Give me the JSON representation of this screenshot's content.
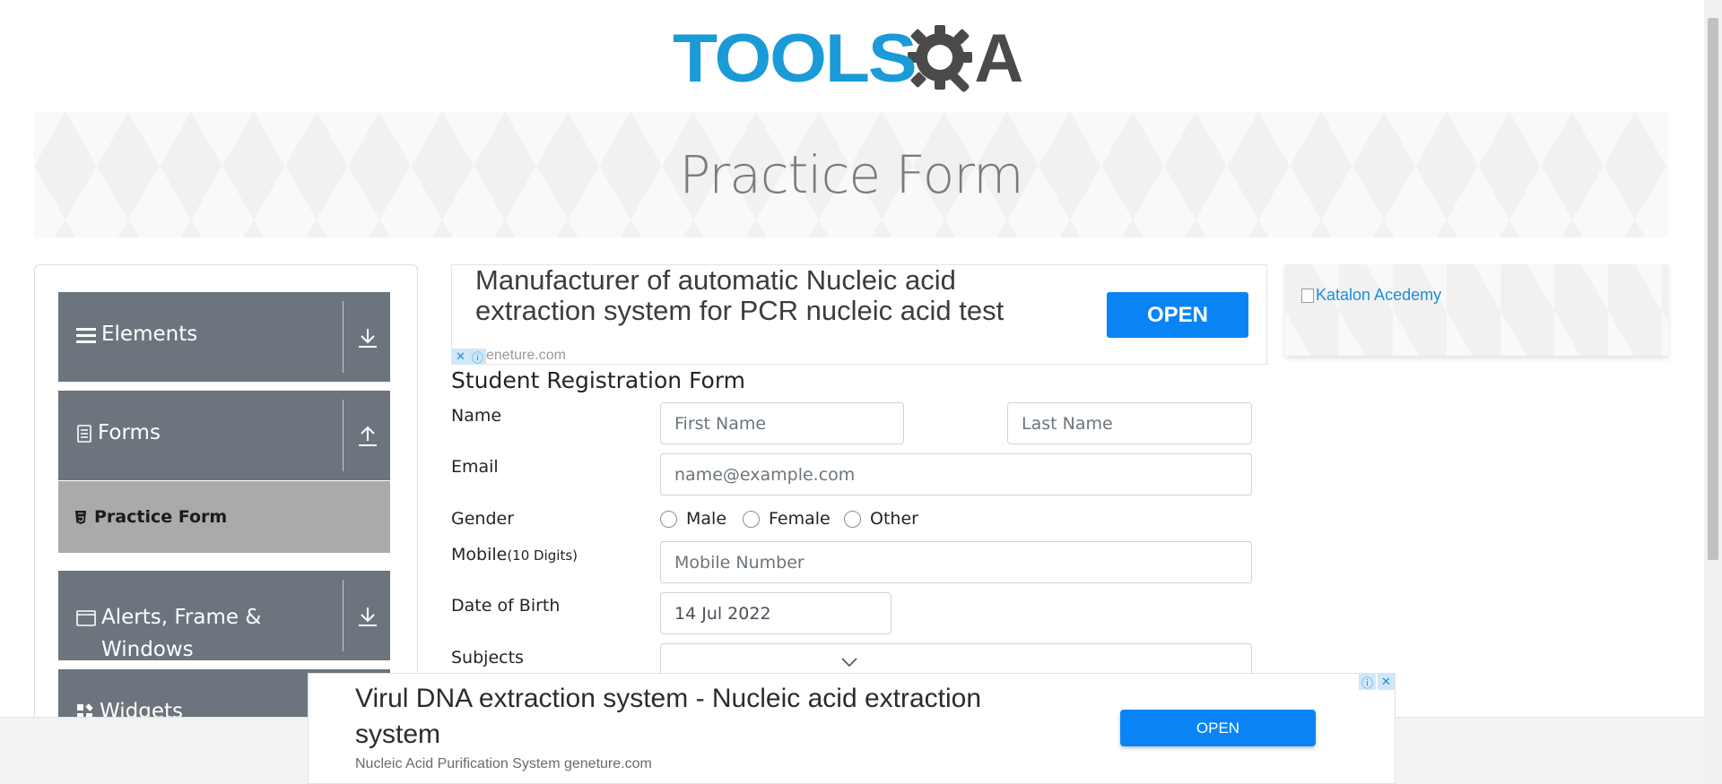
{
  "logo": {
    "part1": "TOOLS",
    "part2": "A",
    "icon": "gear-magnifier-icon",
    "colors": {
      "tools": "#1a9ad6",
      "qa": "#4a4a4a"
    }
  },
  "banner": {
    "title": "Practice Form"
  },
  "sidebar": {
    "groups": [
      {
        "label": "Elements",
        "icon": "hamburger-icon",
        "arrow": "download-arrow-icon"
      },
      {
        "label": "Forms",
        "icon": "document-icon",
        "arrow": "upload-arrow-icon"
      },
      {
        "label": "Alerts, Frame &",
        "label2": "Windows",
        "icon": "window-icon",
        "arrow": "download-arrow-icon"
      },
      {
        "label": "Widgets",
        "icon": "widgets-icon"
      }
    ],
    "active_item": {
      "label": "Practice Form",
      "icon": "html5-shield-icon"
    }
  },
  "ad_top": {
    "text_line1": "Manufacturer of automatic Nucleic acid",
    "text_line2": "extraction system for PCR nucleic acid test",
    "button": "OPEN",
    "domain": "eneture.com"
  },
  "ad_right": {
    "alt_text": "Katalon Acedemy"
  },
  "form": {
    "title": "Student Registration Form",
    "name_label": "Name",
    "first_name_placeholder": "First Name",
    "last_name_placeholder": "Last Name",
    "email_label": "Email",
    "email_placeholder": "name@example.com",
    "gender_label": "Gender",
    "gender_options": [
      "Male",
      "Female",
      "Other"
    ],
    "mobile_label": "Mobile",
    "mobile_hint": "(10 Digits)",
    "mobile_placeholder": "Mobile Number",
    "dob_label": "Date of Birth",
    "dob_value": "14 Jul 2022",
    "subjects_label": "Subjects"
  },
  "ad_bottom": {
    "text_line1": "Virul DNA extraction system - Nucleic acid extraction",
    "text_line2": "system",
    "sub": "Nucleic Acid Purification System geneture.com",
    "button": "OPEN"
  },
  "colors": {
    "sidebar_group": "#6c757d",
    "active_item": "#aaaaaa",
    "ad_button": "#0a84f5",
    "link": "#1a8fd8"
  }
}
